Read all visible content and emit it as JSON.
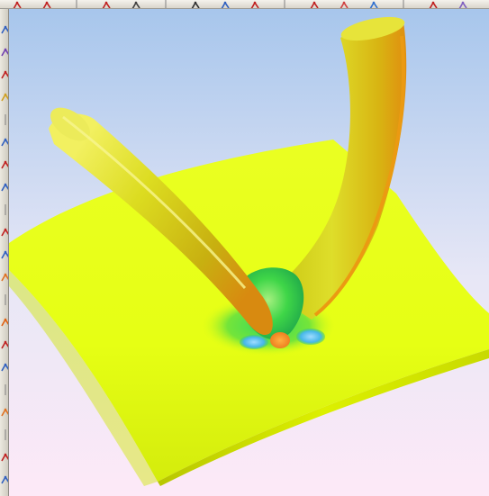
{
  "app": {
    "toolbar": {
      "top_buttons": [
        {
          "icon": "curve-icon",
          "color": "#c02020"
        },
        {
          "icon": "arc-icon",
          "color": "#c02020"
        },
        {
          "icon": "separator-icon",
          "color": "#808080"
        },
        {
          "icon": "rectangle-icon",
          "color": "#c02020"
        },
        {
          "icon": "pentagon-icon",
          "color": "#404040"
        },
        {
          "icon": "separator-icon",
          "color": "#808080"
        },
        {
          "icon": "rotate-view-icon",
          "color": "#303030"
        },
        {
          "icon": "surface-icon",
          "color": "#3060c0"
        },
        {
          "icon": "document-icon",
          "color": "#c02020"
        },
        {
          "icon": "separator-icon",
          "color": "#808080"
        },
        {
          "icon": "sketch-icon",
          "color": "#c02020"
        },
        {
          "icon": "sphere-icon",
          "color": "#d04040"
        },
        {
          "icon": "palette-icon",
          "color": "#3070d0"
        },
        {
          "icon": "separator-icon",
          "color": "#808080"
        },
        {
          "icon": "measure-icon",
          "color": "#c02020"
        },
        {
          "icon": "grid-icon",
          "color": "#8060c0"
        }
      ],
      "left_buttons": [
        {
          "icon": "line-tool-icon",
          "color": "#3060c0"
        },
        {
          "icon": "spline-tool-icon",
          "color": "#7040b0"
        },
        {
          "icon": "point-tool-icon",
          "color": "#c02020"
        },
        {
          "icon": "box-tool-icon",
          "color": "#d0a020"
        },
        {
          "icon": "separator-icon",
          "color": "#808080"
        },
        {
          "icon": "sweep-tool-icon",
          "color": "#3060c0"
        },
        {
          "icon": "blend-tool-icon",
          "color": "#c02020"
        },
        {
          "icon": "fillet-tool-icon",
          "color": "#3060c0"
        },
        {
          "icon": "separator-icon",
          "color": "#808080"
        },
        {
          "icon": "trim-tool-icon",
          "color": "#c02020"
        },
        {
          "icon": "extend-tool-icon",
          "color": "#3060c0"
        },
        {
          "icon": "solid-tool-icon",
          "color": "#e07020"
        },
        {
          "icon": "separator-icon",
          "color": "#808080"
        },
        {
          "icon": "cut-tool-icon",
          "color": "#e06010"
        },
        {
          "icon": "join-tool-icon",
          "color": "#c02020"
        },
        {
          "icon": "surface-tool-icon",
          "color": "#3060c0"
        },
        {
          "icon": "separator-icon",
          "color": "#808080"
        },
        {
          "icon": "volume-tool-icon",
          "color": "#e07020"
        },
        {
          "icon": "separator-icon",
          "color": "#808080"
        },
        {
          "icon": "rotate-tool-icon",
          "color": "#c02020"
        },
        {
          "icon": "view-tool-icon",
          "color": "#3060c0"
        }
      ]
    },
    "viewport": {
      "background_top": "#a7c6ec",
      "background_bottom": "#fde9f7",
      "surface_color": "#e6ff14",
      "tube_color": "#d8d21c",
      "highlight_color": "#3fd648",
      "hotspot_color": "#ee8020",
      "cool_color": "#45b7e8"
    }
  }
}
